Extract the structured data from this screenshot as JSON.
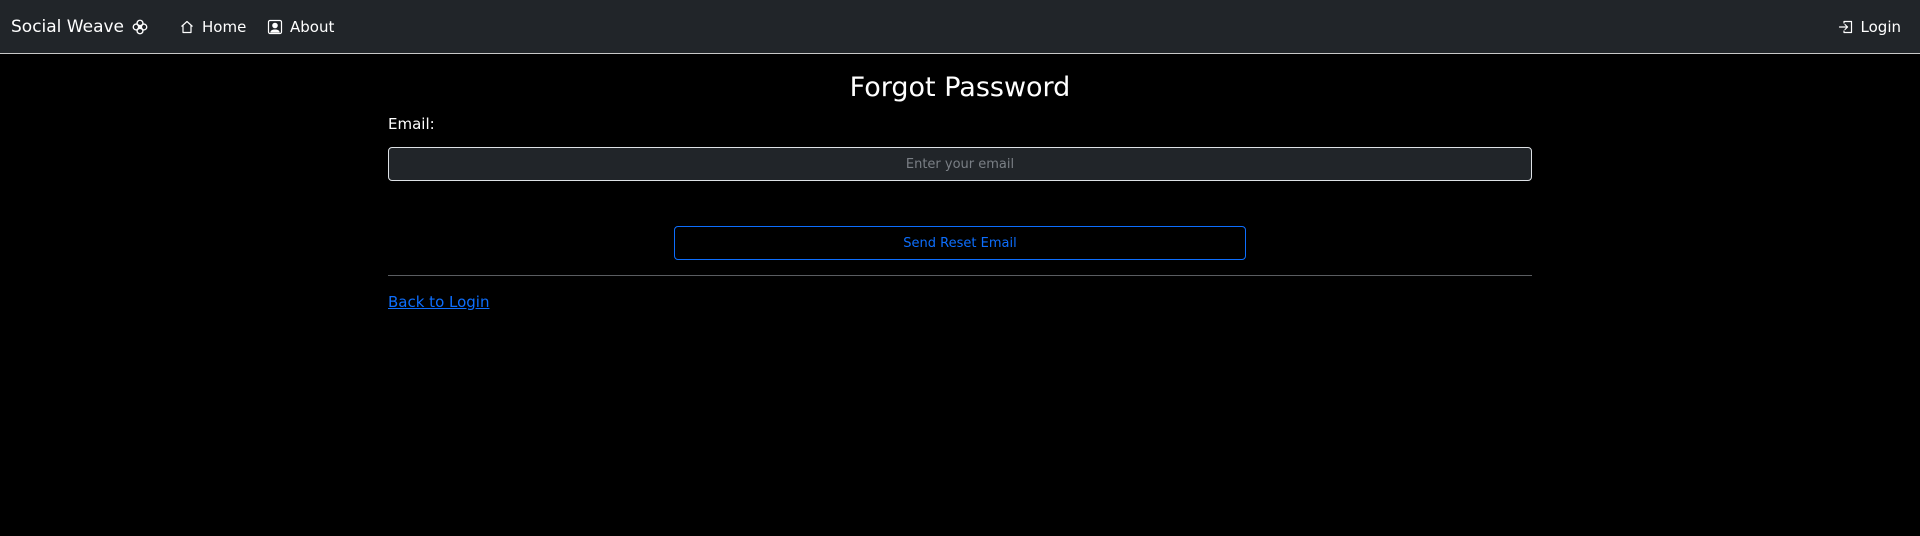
{
  "navbar": {
    "brand": "Social Weave",
    "brand_icon": "flower-icon",
    "links": {
      "home": {
        "label": "Home",
        "icon": "house-icon"
      },
      "about": {
        "label": "About",
        "icon": "person-badge-icon"
      },
      "login": {
        "label": "Login",
        "icon": "box-arrow-in-right-icon"
      }
    }
  },
  "main": {
    "title": "Forgot Password",
    "email_label": "Email:",
    "email_value": "",
    "email_placeholder": "Enter your email",
    "send_button": "Send Reset Email",
    "back_link": "Back to Login"
  },
  "colors": {
    "navbar_bg": "#212529",
    "page_bg": "#000000",
    "accent": "#0d6efd"
  }
}
